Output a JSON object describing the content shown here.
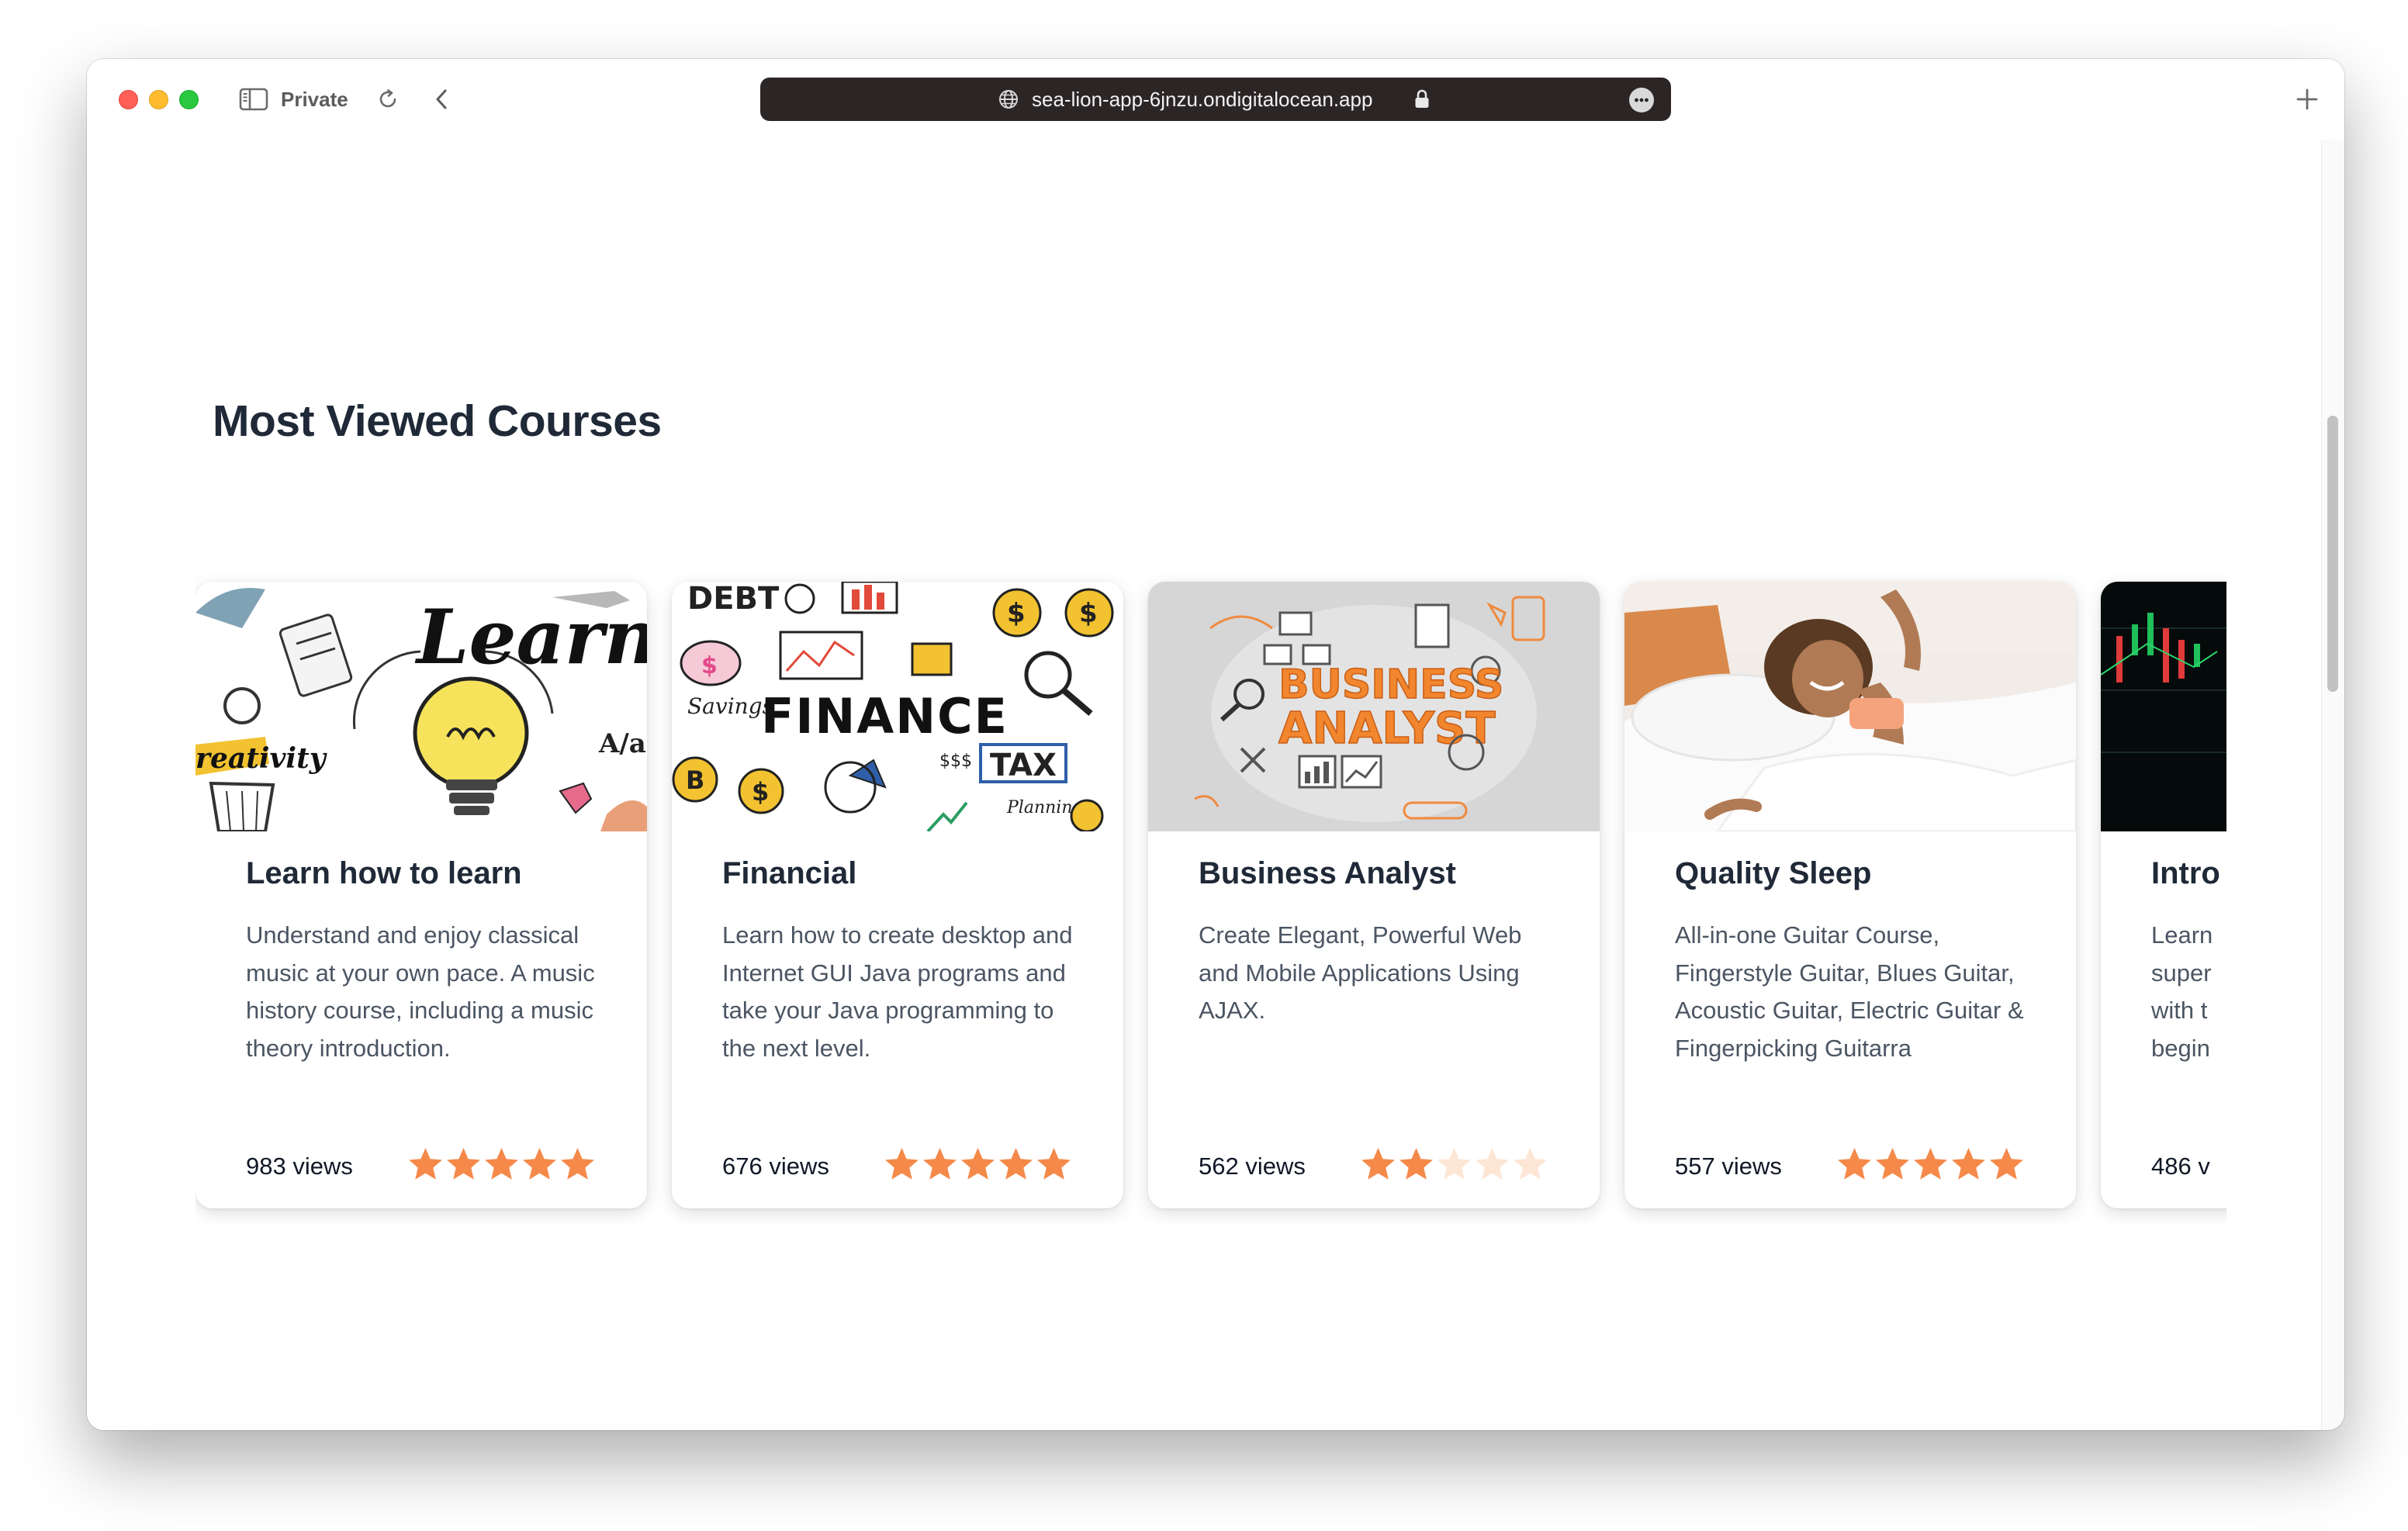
{
  "browser": {
    "private_label": "Private",
    "url": "sea-lion-app-6jnzu.ondigitalocean.app",
    "icons": [
      "sidebar-icon",
      "reload-icon",
      "back-chevron-icon",
      "globe-icon",
      "lock-icon",
      "more-icon",
      "plus-icon"
    ]
  },
  "page": {
    "section_title": "Most Viewed Courses"
  },
  "colors": {
    "star_filled": "#f5894a",
    "star_empty": "#fde6d6",
    "title": "#1f2937",
    "text": "#4b5563",
    "url_bar": "#2b2526"
  },
  "courses": [
    {
      "title": "Learn how to learn",
      "description": "Understand and enjoy classical music at your own pace. A music history course, including a music theory introduction.",
      "views": "983 views",
      "rating": 5,
      "image_label": "Learn"
    },
    {
      "title": "Financial",
      "description": "Learn how to create desktop and Internet GUI Java programs and take your Java programming to the next level.",
      "views": "676 views",
      "rating": 5,
      "image_label": "FINANCE"
    },
    {
      "title": "Business Analyst",
      "description": "Create Elegant, Powerful Web and Mobile Applications Using AJAX.",
      "views": "562 views",
      "rating": 2,
      "image_label": "BUSINESS ANALYST"
    },
    {
      "title": "Quality Sleep",
      "description": "All-in-one Guitar Course, Fingerstyle Guitar, Blues Guitar, Acoustic Guitar, Electric Guitar & Fingerpicking Guitarra",
      "views": "557 views",
      "rating": 5,
      "image_label": ""
    },
    {
      "title": "Intro",
      "description": "Learn super with t begin",
      "views": "486 v",
      "rating": 0,
      "image_label": ""
    }
  ]
}
